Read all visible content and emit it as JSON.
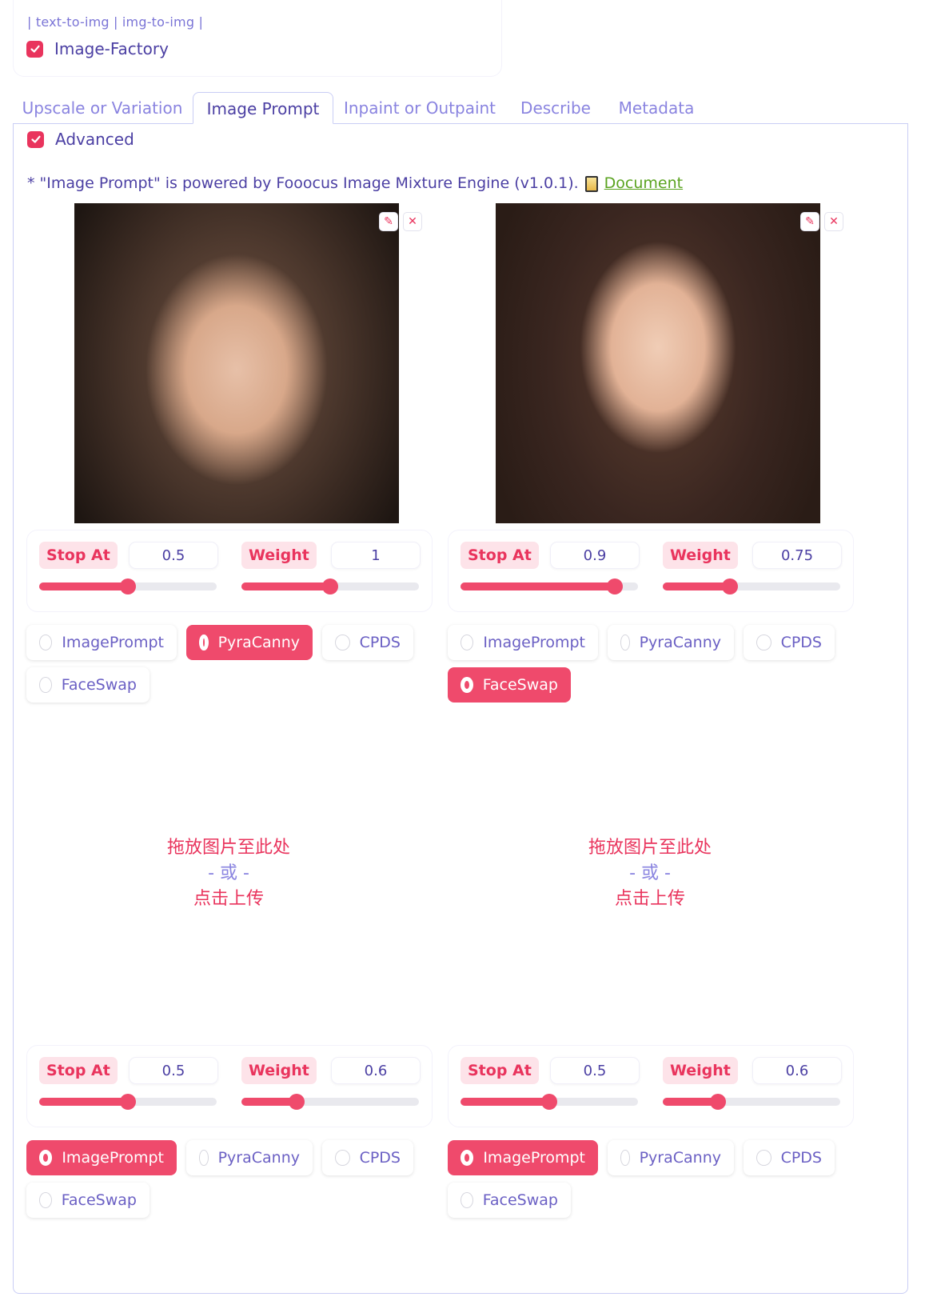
{
  "header": {
    "mode_links": "| text-to-img | img-to-img |",
    "image_factory_label": "Image-Factory"
  },
  "tabs": [
    {
      "label": "Upscale or Variation"
    },
    {
      "label": "Image Prompt"
    },
    {
      "label": "Inpaint or Outpaint"
    },
    {
      "label": "Describe"
    },
    {
      "label": "Metadata"
    }
  ],
  "active_tab": "Image Prompt",
  "advanced_label": "Advanced",
  "note": {
    "text": "* \"Image Prompt\" is powered by Fooocus Image Mixture Engine (v1.0.1).",
    "link": " Document",
    "icon": "document-icon"
  },
  "icons": {
    "edit": "✎",
    "close": "✕"
  },
  "dropzone": {
    "line1": "拖放图片至此处",
    "line2": "- 或 -",
    "line3": "点击上传"
  },
  "slider_labels": {
    "stop_at": "Stop At",
    "weight": "Weight"
  },
  "options": [
    "ImagePrompt",
    "PyraCanny",
    "CPDS",
    "FaceSwap"
  ],
  "slots": [
    {
      "has_image": true,
      "stop_at": "0.5",
      "weight": "1",
      "selected": "PyraCanny"
    },
    {
      "has_image": true,
      "stop_at": "0.9",
      "weight": "0.75",
      "selected": "FaceSwap"
    },
    {
      "has_image": false,
      "stop_at": "0.5",
      "weight": "0.6",
      "selected": "ImagePrompt"
    },
    {
      "has_image": false,
      "stop_at": "0.5",
      "weight": "0.6",
      "selected": "ImagePrompt"
    }
  ],
  "colors": {
    "accent": "#ef4a6c",
    "text": "#4b3fa3",
    "link": "#5aa31f"
  }
}
